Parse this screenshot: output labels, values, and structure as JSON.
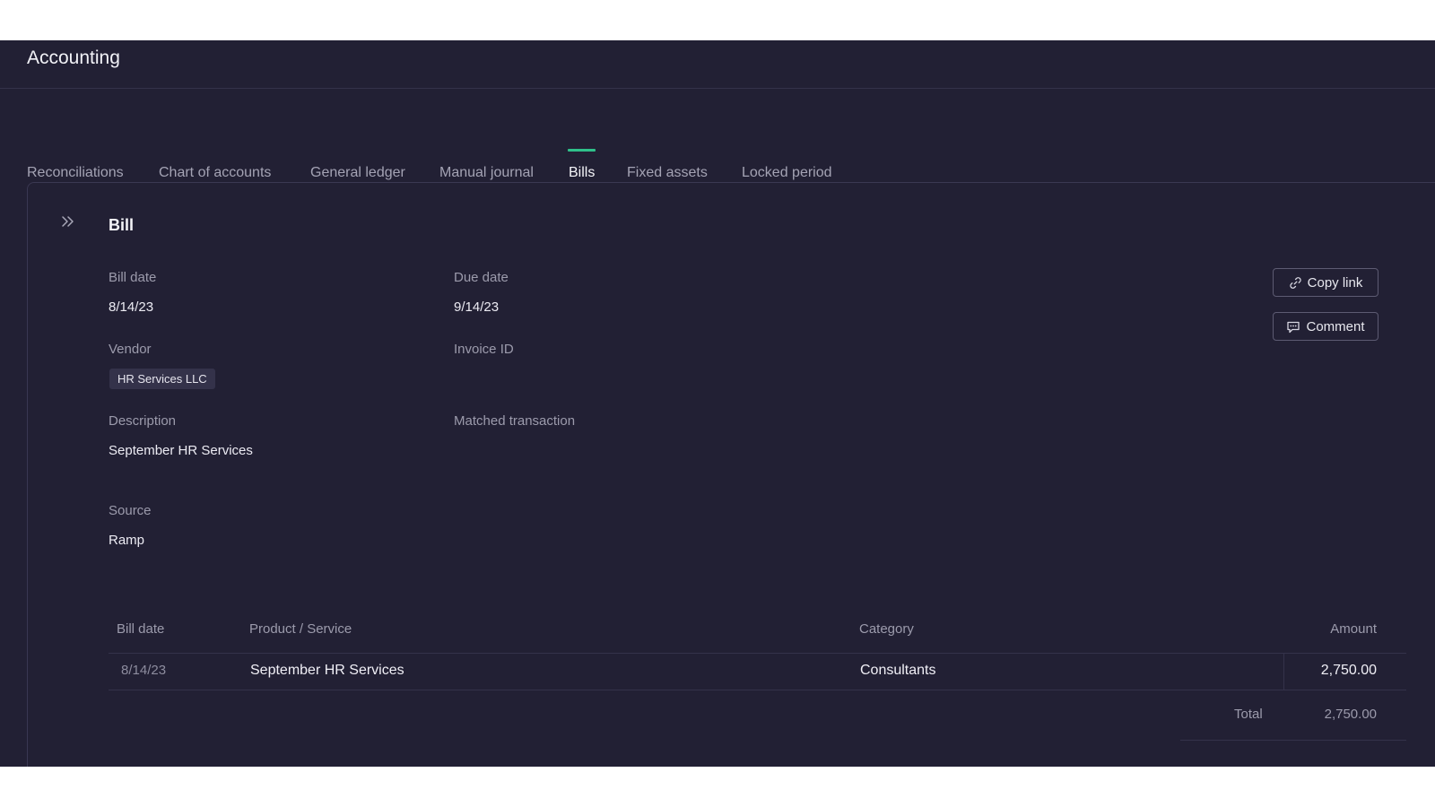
{
  "app": {
    "title": "Accounting"
  },
  "tabs": [
    {
      "label": "Reconciliations",
      "active": false
    },
    {
      "label": "Chart of accounts",
      "active": false
    },
    {
      "label": "General ledger",
      "active": false
    },
    {
      "label": "Manual journal",
      "active": false
    },
    {
      "label": "Bills",
      "active": true
    },
    {
      "label": "Fixed assets",
      "active": false
    },
    {
      "label": "Locked period",
      "active": false
    }
  ],
  "bill": {
    "title": "Bill",
    "fields": {
      "bill_date": {
        "label": "Bill date",
        "value": "8/14/23"
      },
      "due_date": {
        "label": "Due date",
        "value": "9/14/23"
      },
      "vendor": {
        "label": "Vendor",
        "value": "HR Services LLC"
      },
      "invoice_id": {
        "label": "Invoice ID",
        "value": ""
      },
      "description": {
        "label": "Description",
        "value": "September HR Services"
      },
      "matched_transaction": {
        "label": "Matched transaction",
        "value": ""
      },
      "source": {
        "label": "Source",
        "value": "Ramp"
      }
    },
    "actions": {
      "copy_link": {
        "label": "Copy link",
        "icon": "link-icon"
      },
      "comment": {
        "label": "Comment",
        "icon": "comment-icon"
      }
    }
  },
  "line_items": {
    "headers": {
      "bill_date": "Bill date",
      "product": "Product / Service",
      "category": "Category",
      "amount": "Amount"
    },
    "rows": [
      {
        "bill_date": "8/14/23",
        "product": "September HR Services",
        "category": "Consultants",
        "amount": "2,750.00"
      }
    ],
    "total_label": "Total",
    "total_value": "2,750.00"
  },
  "colors": {
    "background": "#222034",
    "accent": "#2fc08a",
    "border": "#34324a"
  }
}
